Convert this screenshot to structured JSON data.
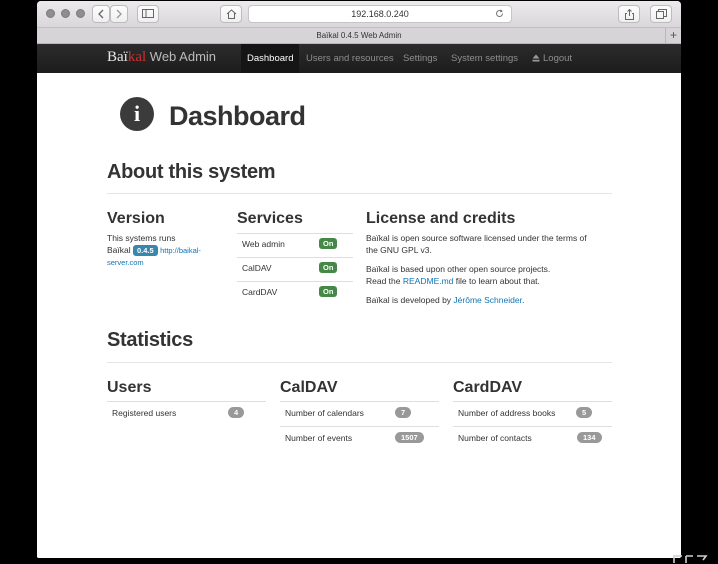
{
  "browser": {
    "url": "192.168.0.240",
    "tab_title": "Baïkal 0.4.5 Web Admin",
    "new_tab": "+"
  },
  "nav": {
    "brand_a": "Baï",
    "brand_b": "kal",
    "brand_c": " Web Admin",
    "items": [
      "Dashboard",
      "Users and resources",
      "Settings",
      "System settings",
      "Logout"
    ]
  },
  "page": {
    "title": "Dashboard",
    "info_glyph": "i"
  },
  "about": {
    "heading": "About this system",
    "version": {
      "heading": "Version",
      "line1": "This systems runs",
      "name": "Baïkal",
      "badge": "0.4.5",
      "link_a": "http://baikal-",
      "link_b": "server.com"
    },
    "services": {
      "heading": "Services",
      "rows": [
        {
          "name": "Web admin",
          "status": "On"
        },
        {
          "name": "CalDAV",
          "status": "On"
        },
        {
          "name": "CardDAV",
          "status": "On"
        }
      ]
    },
    "license": {
      "heading": "License and credits",
      "p1a": "Baïkal is open source software licensed under the terms of",
      "p1b": "the GNU GPL v3.",
      "p2a": "Baïkal is based upon other open source projects.",
      "p2b_pre": "Read the ",
      "p2b_link": "README.md",
      "p2b_post": " file to learn about that.",
      "p3_pre": "Baïkal is developed by ",
      "p3_link": "Jérôme Schneider",
      "p3_post": "."
    }
  },
  "statistics": {
    "heading": "Statistics",
    "users": {
      "heading": "Users",
      "rows": [
        {
          "label": "Registered users",
          "count": "4"
        }
      ]
    },
    "caldav": {
      "heading": "CalDAV",
      "rows": [
        {
          "label": "Number of calendars",
          "count": "7"
        },
        {
          "label": "Number of events",
          "count": "1507"
        }
      ]
    },
    "carddav": {
      "heading": "CardDAV",
      "rows": [
        {
          "label": "Number of address books",
          "count": "5"
        },
        {
          "label": "Number of contacts",
          "count": "134"
        }
      ]
    }
  },
  "colors": {
    "navbar": "#222222",
    "on_badge": "#468847",
    "version_badge": "#3a87ad",
    "count_pill": "#999999",
    "link": "#0f75b7",
    "brand_red": "#d0302e"
  }
}
